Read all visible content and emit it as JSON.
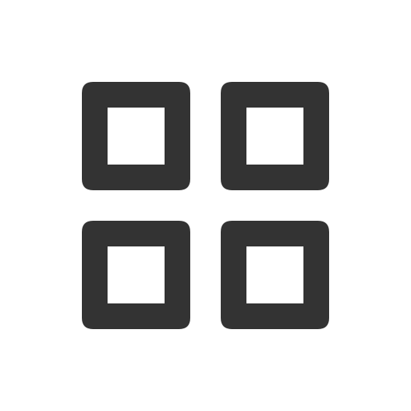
{
  "icon": {
    "name": "grid-icon",
    "color": "#333333",
    "background": "#ffffff",
    "tiles": [
      {
        "name": "top-left"
      },
      {
        "name": "top-right"
      },
      {
        "name": "bottom-left"
      },
      {
        "name": "bottom-right"
      }
    ]
  }
}
